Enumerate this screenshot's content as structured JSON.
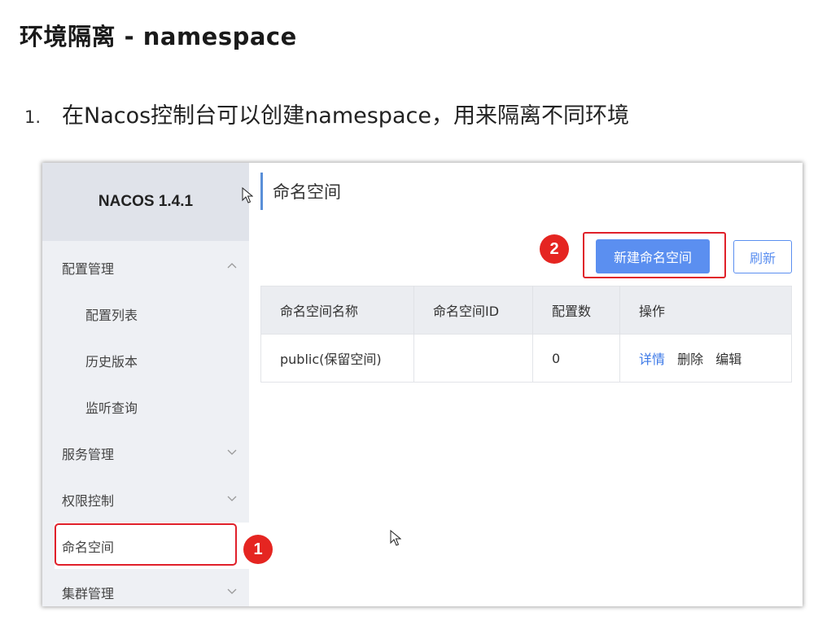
{
  "doc": {
    "title": "环境隔离 - namespace",
    "step_number": "1.",
    "step_text": "在Nacos控制台可以创建namespace，用来隔离不同环境"
  },
  "sidebar": {
    "brand": "NACOS 1.4.1",
    "items": [
      {
        "label": "配置管理",
        "chevron": "chevron-up-icon"
      },
      {
        "label": "配置列表"
      },
      {
        "label": "历史版本"
      },
      {
        "label": "监听查询"
      },
      {
        "label": "服务管理",
        "chevron": "chevron-down-icon"
      },
      {
        "label": "权限控制",
        "chevron": "chevron-down-icon"
      },
      {
        "label": "命名空间",
        "active": true
      },
      {
        "label": "集群管理",
        "chevron": "chevron-down-icon"
      }
    ]
  },
  "main": {
    "header": "命名空间",
    "create_button": "新建命名空间",
    "refresh_button": "刷新",
    "table": {
      "columns": [
        "命名空间名称",
        "命名空间ID",
        "配置数",
        "操作"
      ],
      "rows": [
        {
          "name": "public(保留空间)",
          "id": "",
          "count": "0",
          "actions": [
            "详情",
            "删除",
            "编辑"
          ]
        }
      ]
    }
  },
  "annotations": [
    "1",
    "2"
  ],
  "colors": {
    "accent": "#5b8ff0",
    "highlight": "#e0202a",
    "link": "#3b78e7"
  }
}
